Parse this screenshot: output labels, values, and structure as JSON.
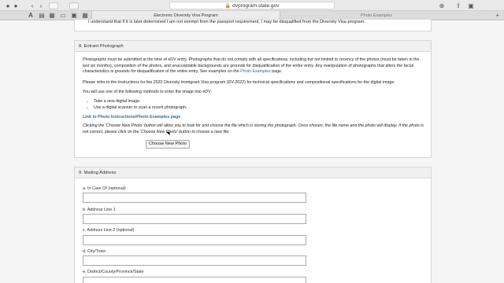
{
  "browser": {
    "url": "dvprogram.state.gov",
    "tabs": [
      {
        "label": "Electronic Diversity Visa Program"
      },
      {
        "label": "Photo Examples"
      }
    ],
    "new_tab": "+"
  },
  "top_text": "I understand that if it is later determined I am not exempt from the passport requirement, I may be disqualified from the Diversity Visa program.",
  "section8": {
    "heading": "8. Entrant Photograph",
    "para1_a": "Photographs must be submitted at the time of eDV entry. Photographs that do not comply with all specifications, including but not limited to recency of the photos (must be taken in the last six months), composition of the photos, and unacceptable backgrounds are grounds for disqualification of the entire entry. Any manipulation of photographs that alters the facial characteristics is grounds for disqualification of the entire entry. See examples on the",
    "para1_link": "Photo Examples",
    "para1_b": "page.",
    "para2": "Please refer to the Instructions for the 2022 Diversity Immigrant Visa program (DV-2022) for technical specifications and compositional specifications for the digital image.",
    "para3": "You will use one of the following methods to enter the image into eDV:",
    "bullets": [
      "Take a new digital image.",
      "Use a digital scanner to scan a recent photograph."
    ],
    "link": "Link to Photo Instructions/Photo Examples page",
    "note": "Clicking the 'Choose New Photo' button will allow you to look for and choose the file which is storing the photograph. Once chosen, the file name and the photo will display. If the photo is not correct, please click on the 'Choose New Photo' button to choose a new file.",
    "button": "Choose New Photo"
  },
  "section9": {
    "heading": "9. Mailing Address",
    "fields": [
      {
        "label": "a. In Care Of (optional)",
        "value": ""
      },
      {
        "label": "b. Address Line 1",
        "value": ""
      },
      {
        "label": "c. Address Line 2 (optional)",
        "value": ""
      },
      {
        "label": "d. City/Town",
        "value": ""
      },
      {
        "label": "e. District/County/Province/State",
        "value": ""
      }
    ]
  }
}
